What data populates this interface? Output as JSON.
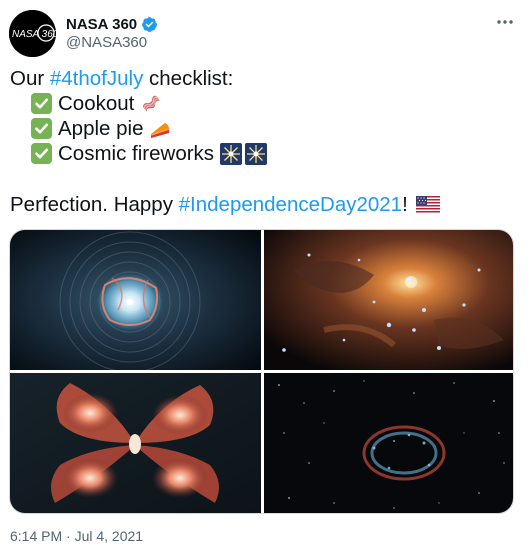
{
  "author": {
    "display_name": "NASA 360",
    "handle": "@NASA360",
    "avatar_text": "NASA 360",
    "verified": true
  },
  "tweet": {
    "line1_prefix": "Our ",
    "line1_hashtag": "#4thofJuly",
    "line1_suffix": " checklist:",
    "items": [
      {
        "text": "Cookout",
        "emoji": "bacon-emoji"
      },
      {
        "text": "Apple pie",
        "emoji": "pie-emoji"
      },
      {
        "text": "Cosmic fireworks",
        "emoji": "sparkler-emoji"
      }
    ],
    "line5_prefix": "Perfection. Happy ",
    "line5_hashtag": "#IndependenceDay2021",
    "line5_suffix": "!",
    "flag_emoji": "us-flag-emoji"
  },
  "timestamp": "6:14 PM · Jul 4, 2021",
  "colors": {
    "link": "#1d9bf0",
    "verified": "#1d9bf0",
    "secondary": "#536471",
    "check": "#77b255"
  }
}
